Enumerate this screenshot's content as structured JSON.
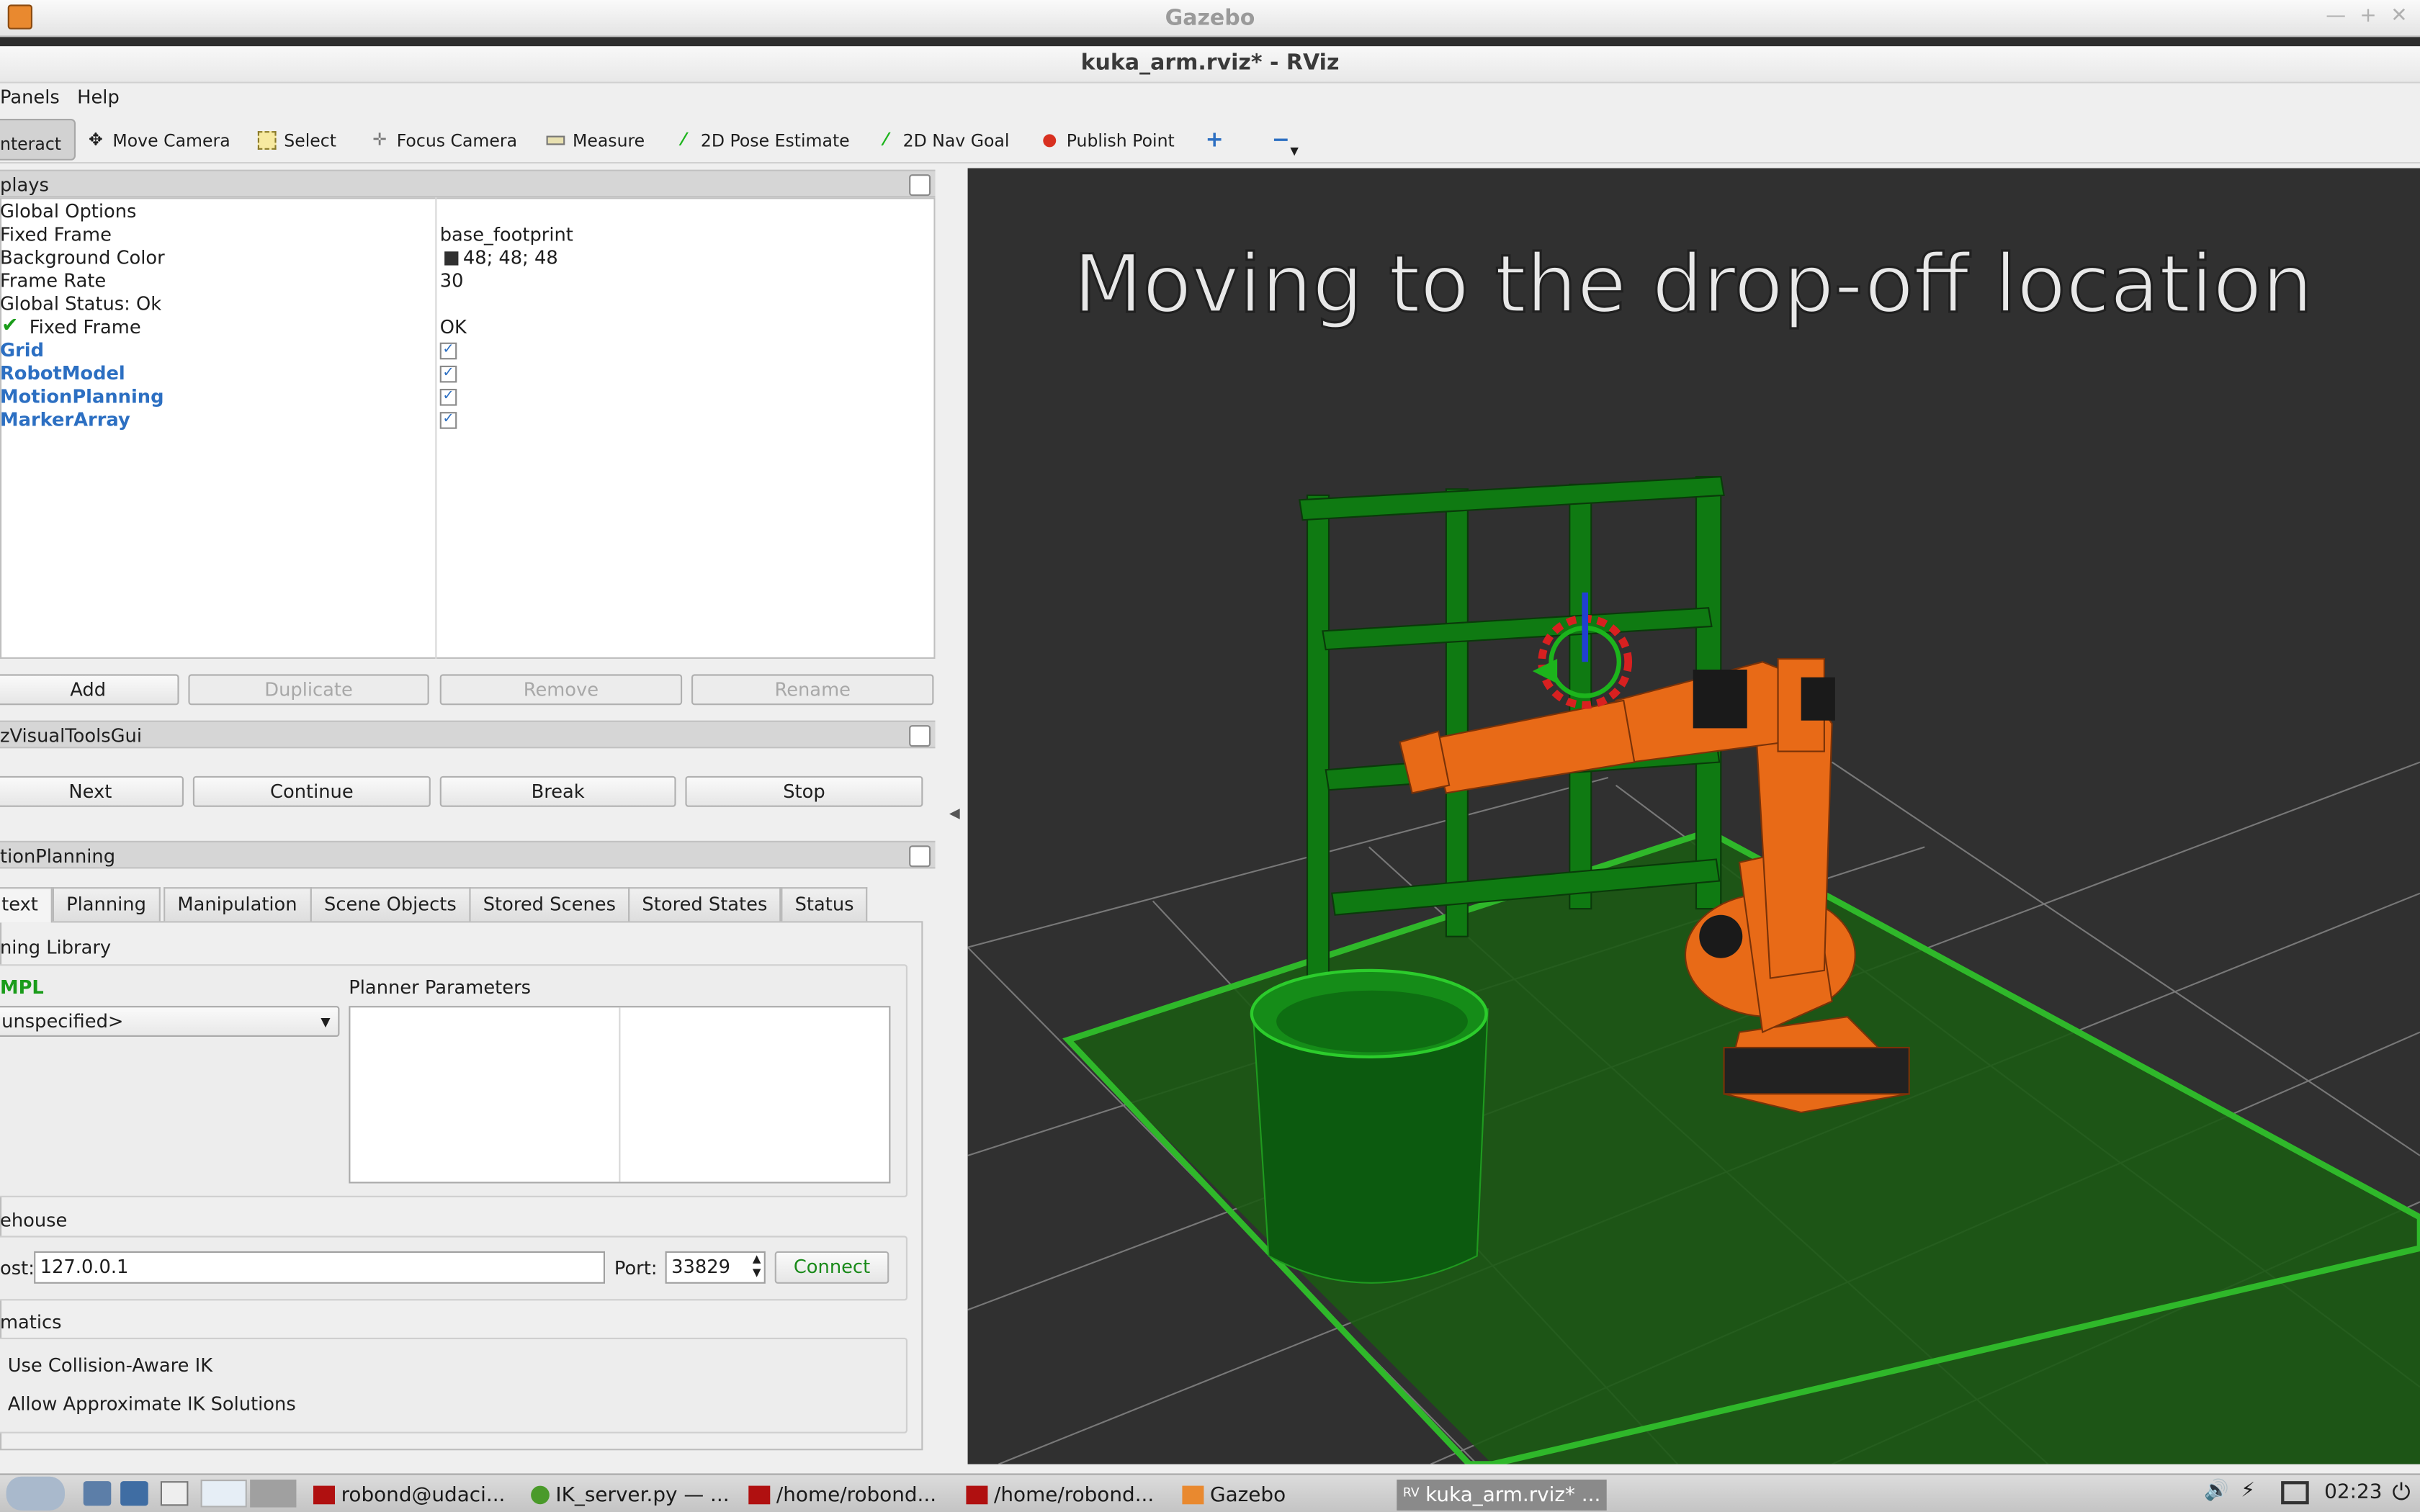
{
  "gazebo_window": {
    "title": "Gazebo",
    "controls": [
      "—",
      "+",
      "✕"
    ]
  },
  "rviz_window": {
    "title": "kuka_arm.rviz* - RViz"
  },
  "menu": [
    "Panels",
    "Help"
  ],
  "toolbar": {
    "interact": "nteract",
    "move_camera": "Move Camera",
    "select": "Select",
    "focus_camera": "Focus Camera",
    "measure": "Measure",
    "pose_estimate": "2D Pose Estimate",
    "nav_goal": "2D Nav Goal",
    "publish_point": "Publish Point",
    "add_tool": "+",
    "remove_tool": "−"
  },
  "displays": {
    "header": "plays",
    "rows": [
      {
        "name": "Global Options",
        "value": ""
      },
      {
        "name": "Fixed Frame",
        "value": "base_footprint"
      },
      {
        "name": "Background Color",
        "value": "48; 48; 48"
      },
      {
        "name": "Frame Rate",
        "value": "30"
      },
      {
        "name": "Global Status: Ok",
        "value": ""
      },
      {
        "name": "Fixed Frame",
        "value": "OK"
      }
    ],
    "plugins": [
      "Grid",
      "RobotModel",
      "MotionPlanning",
      "MarkerArray"
    ],
    "buttons": {
      "add": "Add",
      "duplicate": "Duplicate",
      "remove": "Remove",
      "rename": "Rename"
    }
  },
  "visual_tools": {
    "header": "zVisualToolsGui",
    "buttons": {
      "next": "Next",
      "continue": "Continue",
      "break": "Break",
      "stop": "Stop"
    }
  },
  "motion_planning": {
    "header": "tionPlanning",
    "tabs": [
      "text",
      "Planning",
      "Manipulation",
      "Scene Objects",
      "Stored Scenes",
      "Stored States",
      "Status"
    ],
    "planning_library_label": "ning Library",
    "ompl_label": "MPL",
    "planner_select": "unspecified>",
    "planner_params_label": "Planner Parameters",
    "warehouse_label": "ehouse",
    "host_label": "ost:",
    "host_value": "127.0.0.1",
    "port_label": "Port:",
    "port_value": "33829",
    "connect": "Connect",
    "kinematics_label": "matics",
    "collision_ik": "Use Collision-Aware IK",
    "approx_ik": "Allow Approximate IK Solutions"
  },
  "viewport": {
    "overlay_text": "Moving  to  the  drop-off  location",
    "background": "#303030"
  },
  "taskbar": {
    "tasks": [
      "robond@udaci...",
      "IK_server.py — ...",
      "/home/robond...",
      "/home/robond...",
      "Gazebo",
      "kuka_arm.rviz* ..."
    ],
    "clock": "02:23"
  }
}
